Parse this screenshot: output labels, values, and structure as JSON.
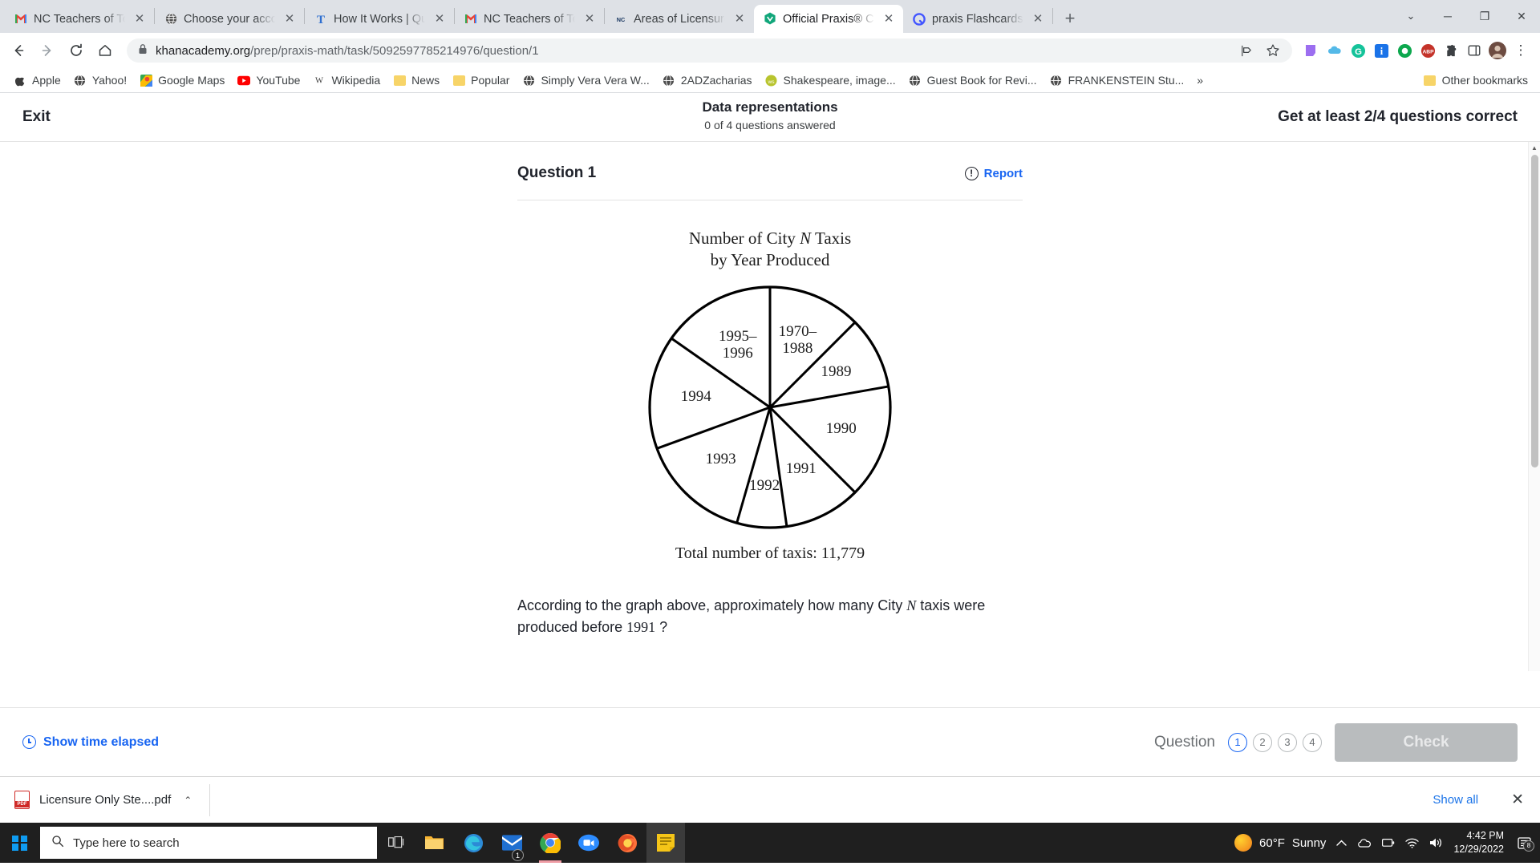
{
  "browser": {
    "tabs": [
      {
        "title": "NC Teachers of Tomor",
        "favicon": "gmail-icon",
        "active": false
      },
      {
        "title": "Choose your account",
        "favicon": "globe-icon",
        "active": false
      },
      {
        "title": "How It Works | Quicke",
        "favicon": "t-icon",
        "active": false
      },
      {
        "title": "NC Teachers of Tomor",
        "favicon": "gmail-icon",
        "active": false
      },
      {
        "title": "Areas of Licensure | N",
        "favicon": "nc-icon",
        "active": false
      },
      {
        "title": "Official Praxis® Core",
        "favicon": "praxis-icon",
        "active": true
      },
      {
        "title": "praxis Flashcards | Qu",
        "favicon": "quizlet-icon",
        "active": false
      }
    ],
    "new_tab_label": "+",
    "close_label": "✕",
    "window_controls": {
      "chevron": "⌄",
      "minimize": "─",
      "maximize": "❐",
      "close": "✕"
    },
    "nav": {
      "back": "←",
      "forward": "→",
      "reload": "⟳",
      "home": "⌂"
    },
    "omnibox": {
      "lock_icon": "lock-icon",
      "url_domain": "khanacademy.org",
      "url_path": "/prep/praxis-math/task/5092597785214976/question/1",
      "share_icon": "share-icon",
      "bookmark_icon": "star-icon"
    },
    "extensions": [
      {
        "name": "purple-extension-icon",
        "color": "#9c6ef0",
        "glyph": ""
      },
      {
        "name": "cloud-extension-icon",
        "color": "#54b9e8",
        "glyph": ""
      },
      {
        "name": "grammarly-icon",
        "color": "#15c39a",
        "glyph": "G"
      },
      {
        "name": "info-extension-icon",
        "color": "#1a73e8",
        "glyph": "i"
      },
      {
        "name": "green-circle-icon",
        "color": "#0da84e",
        "glyph": ""
      },
      {
        "name": "adblock-plus-icon",
        "color": "#c4332a",
        "glyph": "ABP"
      },
      {
        "name": "puzzle-extensions-icon",
        "color": "#5f6368",
        "glyph": "❖"
      },
      {
        "name": "sidepanel-icon",
        "color": "#5f6368",
        "glyph": "▣"
      },
      {
        "name": "profile-avatar",
        "color": "#6d4c41",
        "glyph": ""
      },
      {
        "name": "chrome-menu-icon",
        "color": "#5f6368",
        "glyph": "⋮"
      }
    ],
    "bookmarks": [
      {
        "label": "Apple",
        "icon": "apple-icon"
      },
      {
        "label": "Yahoo!",
        "icon": "yahoo-icon"
      },
      {
        "label": "Google Maps",
        "icon": "maps-icon"
      },
      {
        "label": "YouTube",
        "icon": "youtube-icon"
      },
      {
        "label": "Wikipedia",
        "icon": "wikipedia-icon"
      },
      {
        "label": "News",
        "icon": "folder-icon"
      },
      {
        "label": "Popular",
        "icon": "folder-icon"
      },
      {
        "label": "Simply Vera Vera W...",
        "icon": "globe-icon"
      },
      {
        "label": "2ADZacharias",
        "icon": "globe-icon"
      },
      {
        "label": "Shakespeare, image...",
        "icon": "site-icon"
      },
      {
        "label": "Guest Book for Revi...",
        "icon": "globe-icon"
      },
      {
        "label": "FRANKENSTEIN Stu...",
        "icon": "globe-icon"
      }
    ],
    "bookmarks_overflow": "»",
    "other_bookmarks": {
      "label": "Other bookmarks",
      "icon": "folder-icon"
    }
  },
  "khan": {
    "exit_label": "Exit",
    "title": "Data representations",
    "subtitle": "0 of 4 questions answered",
    "goal": "Get at least 2/4 questions correct",
    "question_number": "Question 1",
    "report_label": "Report",
    "report_icon": "!",
    "question_text_before": "According to the graph above, approximately how many City ",
    "question_var": "N",
    "question_text_mid": " taxis were produced before ",
    "question_year": "1991",
    "question_text_after": " ?",
    "footer": {
      "show_time_label": "Show time elapsed",
      "question_label": "Question",
      "dots": [
        "1",
        "2",
        "3",
        "4"
      ],
      "current_dot": "1",
      "check_label": "Check"
    },
    "accent_blue": "#1865f2"
  },
  "chart_data": {
    "type": "pie",
    "title_line1_before": "Number of City ",
    "title_line1_var": "N",
    "title_line1_after": " Taxis",
    "title_line2": "by Year Produced",
    "title": "Number of City N Taxis by Year Produced",
    "total_label": "Total number of taxis: 11,779",
    "total_value": 11779,
    "legend": "none",
    "grid": false,
    "start_angle_deg": 0,
    "direction": "clockwise",
    "slices": [
      {
        "label": "1970–1988",
        "start_deg": 0,
        "end_deg": 45,
        "sweep_deg": 45,
        "label_r": 0.6,
        "label_lines": [
          "1970–",
          "1988"
        ]
      },
      {
        "label": "1989",
        "start_deg": 45,
        "end_deg": 80,
        "sweep_deg": 35,
        "label_r": 0.62,
        "label_lines": [
          "1989"
        ]
      },
      {
        "label": "1990",
        "start_deg": 80,
        "end_deg": 135,
        "sweep_deg": 55,
        "label_r": 0.62,
        "label_lines": [
          "1990"
        ]
      },
      {
        "label": "1991",
        "start_deg": 135,
        "end_deg": 172,
        "sweep_deg": 37,
        "label_r": 0.58,
        "label_lines": [
          "1991"
        ]
      },
      {
        "label": "1992",
        "start_deg": 172,
        "end_deg": 196,
        "sweep_deg": 24,
        "label_r": 0.66,
        "label_lines": [
          "1992"
        ]
      },
      {
        "label": "1993",
        "start_deg": 196,
        "end_deg": 250,
        "sweep_deg": 54,
        "label_r": 0.6,
        "label_lines": [
          "1993"
        ]
      },
      {
        "label": "1994",
        "start_deg": 250,
        "end_deg": 305,
        "sweep_deg": 55,
        "label_r": 0.62,
        "label_lines": [
          "1994"
        ]
      },
      {
        "label": "1995–1996",
        "start_deg": 305,
        "end_deg": 360,
        "sweep_deg": 55,
        "label_r": 0.58,
        "label_lines": [
          "1995–",
          "1996"
        ]
      }
    ]
  },
  "downloads": {
    "file_name": "Licensure Only Ste....pdf",
    "file_icon": "pdf-icon",
    "caret": "⌃",
    "show_all_label": "Show all",
    "close_label": "✕"
  },
  "taskbar": {
    "start_icon": "windows-icon",
    "search_placeholder": "Type here to search",
    "search_icon": "search-icon",
    "apps": [
      {
        "name": "task-view-icon",
        "glyph": "⌸"
      },
      {
        "name": "file-explorer-icon",
        "glyph": ""
      },
      {
        "name": "edge-icon",
        "glyph": ""
      },
      {
        "name": "mail-icon",
        "glyph": "",
        "badge": "1"
      },
      {
        "name": "chrome-icon",
        "glyph": ""
      },
      {
        "name": "zoom-icon",
        "glyph": "zoom"
      },
      {
        "name": "firefox-icon",
        "glyph": ""
      },
      {
        "name": "sticky-notes-icon",
        "glyph": ""
      }
    ],
    "weather_temp": "60°F",
    "weather_desc": "Sunny",
    "tray_icons": [
      {
        "name": "show-hidden-icons",
        "glyph": "⌃"
      },
      {
        "name": "onedrive-icon",
        "glyph": "☁"
      },
      {
        "name": "battery-icon",
        "glyph": "▮"
      },
      {
        "name": "wifi-icon",
        "glyph": "◠"
      },
      {
        "name": "volume-icon",
        "glyph": "🔊"
      }
    ],
    "time": "4:42 PM",
    "date": "12/29/2022",
    "notification_count": "8"
  }
}
